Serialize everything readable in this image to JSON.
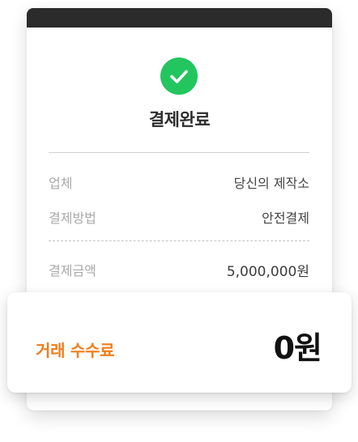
{
  "receipt": {
    "title": "결제완료",
    "status_icon": "check-circle-icon",
    "accent_color": "#22c55e",
    "rows": [
      {
        "label": "업체",
        "value": "당신의 제작소"
      },
      {
        "label": "결제방법",
        "value": "안전결제"
      },
      {
        "label": "결제금액",
        "value": "5,000,000원"
      }
    ]
  },
  "fee": {
    "label": "거래 수수료",
    "value": "0원",
    "label_color": "#f07d1a"
  }
}
